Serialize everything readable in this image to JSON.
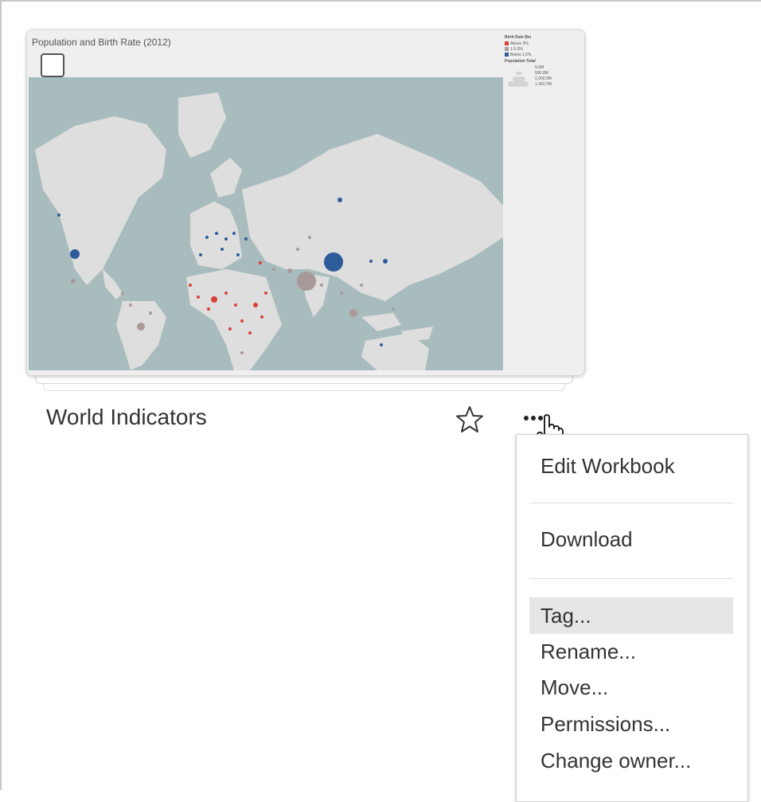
{
  "card": {
    "viz_title": "Population and Birth Rate (2012)",
    "legend": {
      "heading1": "Birth Rate Bin",
      "bins": [
        {
          "label": "Above 3%",
          "color": "#d9403a"
        },
        {
          "label": "1.5-3%",
          "color": "#a89a98"
        },
        {
          "label": "Below 1.5%",
          "color": "#2e5c9a"
        }
      ],
      "heading2": "Population Total",
      "sizes": [
        "0.0M",
        "500.0M",
        "1,000.0M",
        "1,360.7M"
      ]
    },
    "map_colors": {
      "ocean": "#a9bcbd",
      "land": "#dedede"
    }
  },
  "workbook": {
    "name": "World Indicators",
    "star_icon": "star-outline-icon",
    "more_icon": "more-actions-icon"
  },
  "menu": {
    "items": [
      {
        "label": "Edit Workbook"
      },
      {
        "label": "Download"
      },
      {
        "label": "Tag..."
      },
      {
        "label": "Rename..."
      },
      {
        "label": "Move..."
      },
      {
        "label": "Permissions..."
      },
      {
        "label": "Change owner..."
      }
    ],
    "hovered": "Tag..."
  }
}
